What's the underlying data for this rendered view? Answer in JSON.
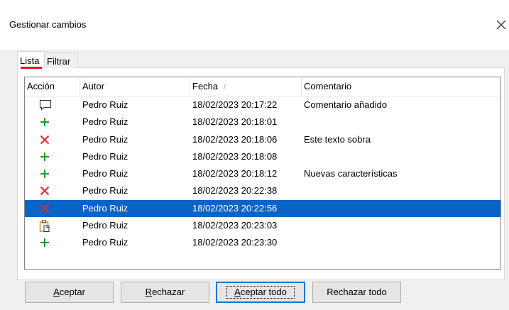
{
  "window": {
    "title": "Gestionar cambios",
    "close_icon": "close-icon"
  },
  "tabs": [
    {
      "label": "Lista",
      "active": true
    },
    {
      "label": "Filtrar",
      "active": false
    }
  ],
  "columns": {
    "accion": "Acción",
    "autor": "Autor",
    "fecha": "Fecha",
    "fecha_sort": "/",
    "comentario": "Comentario"
  },
  "rows": [
    {
      "icon": "comment-icon",
      "autor": "Pedro Ruiz",
      "fecha": "18/02/2023 20:17:22",
      "comentario": "Comentario añadido",
      "selected": false
    },
    {
      "icon": "insert-icon",
      "autor": "Pedro Ruiz",
      "fecha": "18/02/2023 20:18:01",
      "comentario": "",
      "selected": false
    },
    {
      "icon": "delete-icon",
      "autor": "Pedro Ruiz",
      "fecha": "18/02/2023 20:18:06",
      "comentario": "Este texto sobra",
      "selected": false
    },
    {
      "icon": "insert-icon",
      "autor": "Pedro Ruiz",
      "fecha": "18/02/2023 20:18:08",
      "comentario": "",
      "selected": false
    },
    {
      "icon": "insert-icon",
      "autor": "Pedro Ruiz",
      "fecha": "18/02/2023 20:18:12",
      "comentario": "Nuevas características",
      "selected": false
    },
    {
      "icon": "delete-icon",
      "autor": "Pedro Ruiz",
      "fecha": "18/02/2023 20:22:38",
      "comentario": "",
      "selected": false
    },
    {
      "icon": "delete-icon",
      "autor": "Pedro Ruiz",
      "fecha": "18/02/2023 20:22:56",
      "comentario": "",
      "selected": true
    },
    {
      "icon": "attribute-change-icon",
      "autor": "Pedro Ruiz",
      "fecha": "18/02/2023 20:23:03",
      "comentario": "",
      "selected": false
    },
    {
      "icon": "insert-icon",
      "autor": "Pedro Ruiz",
      "fecha": "18/02/2023 20:23:30",
      "comentario": "",
      "selected": false
    }
  ],
  "buttons": {
    "aceptar": {
      "mnemonic": "A",
      "rest": "ceptar"
    },
    "rechazar": {
      "mnemonic": "R",
      "rest": "echazar"
    },
    "aceptar_todo": {
      "mnemonic": "A",
      "rest": "ceptar todo"
    },
    "rechazar_todo": {
      "label": "Rechazar todo"
    }
  },
  "colors": {
    "selection": "#0a64c8",
    "insert": "#1a9c2c",
    "delete": "#e0282e",
    "tab_underline": "#e01b24",
    "default_button_border": "#0078d7",
    "attribute": "#d08a1c"
  }
}
